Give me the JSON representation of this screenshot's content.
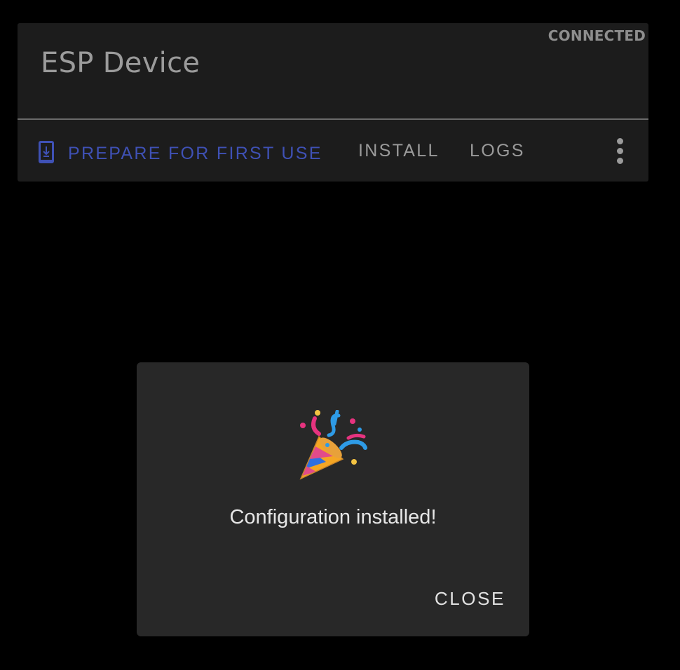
{
  "device": {
    "title": "ESP Device",
    "status": "CONNECTED"
  },
  "actions": {
    "prepare_label": "PREPARE FOR FIRST USE",
    "prepare_icon": "phone-download-icon",
    "install_label": "INSTALL",
    "logs_label": "LOGS",
    "more_icon": "more-vert-icon"
  },
  "dialog": {
    "icon": "party-popper-icon",
    "message": "Configuration installed!",
    "close_label": "CLOSE"
  },
  "colors": {
    "primary": "#3f51b5",
    "card_bg": "#1c1c1c",
    "dialog_bg": "#282828",
    "page_bg": "#000000"
  }
}
